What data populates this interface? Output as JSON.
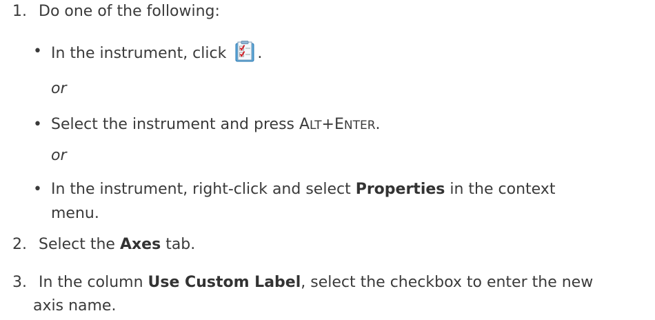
{
  "steps": [
    {
      "number": "1.",
      "text": "Do one of the following:"
    },
    {
      "number": "2.",
      "pre": "Select the ",
      "bold": "Axes",
      "post": " tab."
    },
    {
      "number": "3.",
      "pre": "In the column ",
      "bold": "Use Custom Label",
      "post": ", select the checkbox to enter the new",
      "line2": "axis name."
    }
  ],
  "options": [
    {
      "pre": "In the instrument, click ",
      "icon": "properties-checklist-icon",
      "post": "."
    },
    {
      "pre": "Select the instrument and press A",
      "sc1": "LT",
      "mid": "+E",
      "sc2": "NTER",
      "post": "."
    },
    {
      "pre": "In the instrument, right-click and select ",
      "bold": "Properties",
      "post": " in the context",
      "line2": "menu."
    }
  ],
  "or_text": "or"
}
